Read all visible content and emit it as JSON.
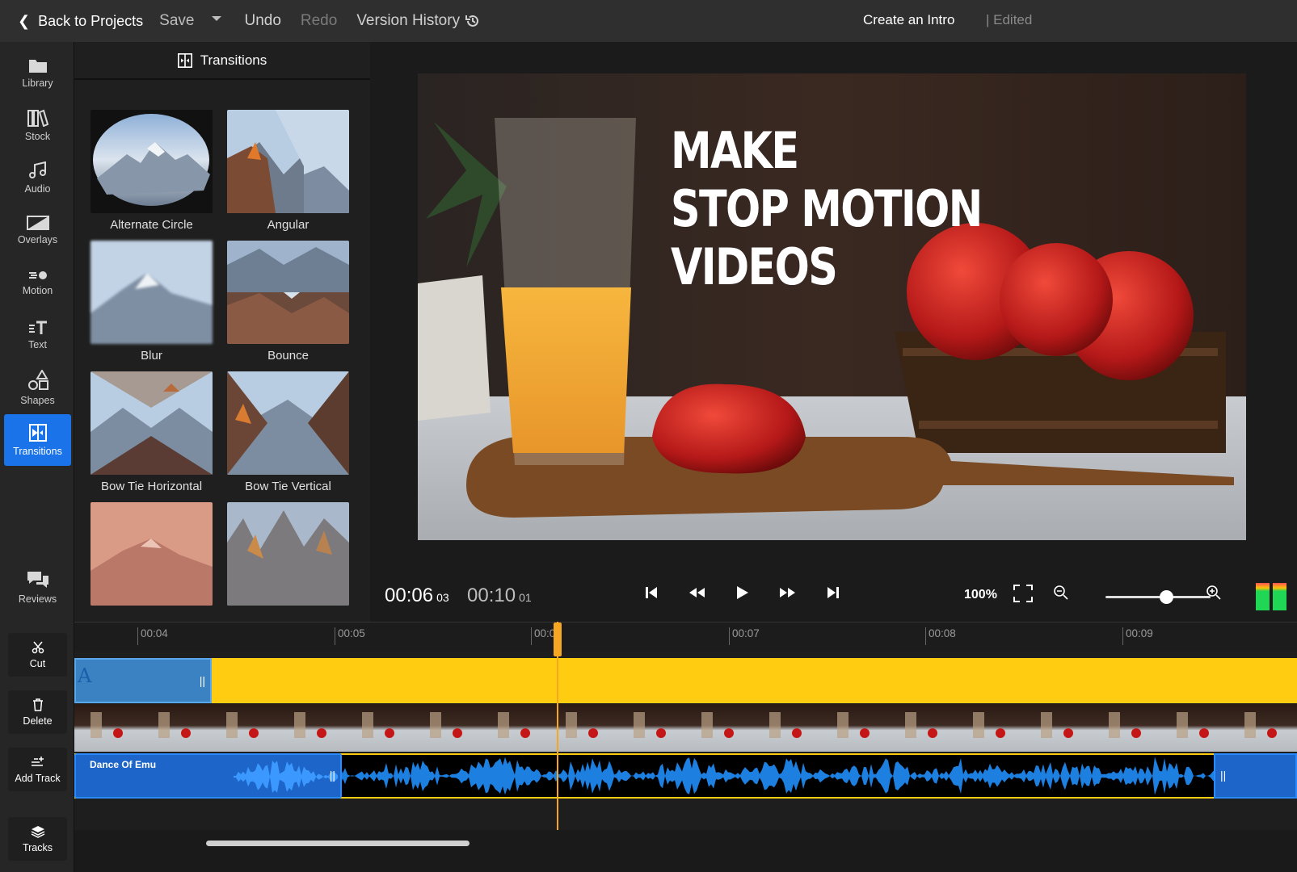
{
  "topbar": {
    "back_label": "Back to Projects",
    "save_label": "Save",
    "undo_label": "Undo",
    "redo_label": "Redo",
    "version_history_label": "Version History",
    "project_name": "Create an Intro",
    "status": "| Edited"
  },
  "rail": {
    "items": [
      {
        "label": "Library",
        "icon": "folder-icon"
      },
      {
        "label": "Stock",
        "icon": "books-icon"
      },
      {
        "label": "Audio",
        "icon": "music-note-icon"
      },
      {
        "label": "Overlays",
        "icon": "overlay-icon"
      },
      {
        "label": "Motion",
        "icon": "motion-icon"
      },
      {
        "label": "Text",
        "icon": "text-icon"
      },
      {
        "label": "Shapes",
        "icon": "shapes-icon"
      },
      {
        "label": "Transitions",
        "icon": "transitions-icon",
        "active": true
      },
      {
        "label": "Reviews",
        "icon": "chat-icon"
      }
    ]
  },
  "panel": {
    "title": "Transitions",
    "tiles": [
      {
        "label": "Alternate Circle"
      },
      {
        "label": "Angular"
      },
      {
        "label": "Blur"
      },
      {
        "label": "Bounce"
      },
      {
        "label": "Bow Tie Horizontal"
      },
      {
        "label": "Bow Tie Vertical"
      },
      {
        "label": ""
      },
      {
        "label": ""
      }
    ]
  },
  "preview": {
    "title_lines": [
      "MAKE",
      "STOP MOTION",
      "VIDEOS"
    ]
  },
  "transport": {
    "current_time": "00:06",
    "current_frames": "03",
    "total_time": "00:10",
    "total_frames": "01",
    "zoom": "100%"
  },
  "timeline_tools": [
    {
      "label": "Cut",
      "icon": "scissors-icon"
    },
    {
      "label": "Delete",
      "icon": "trash-icon"
    },
    {
      "label": "Add Track",
      "icon": "add-track-icon"
    },
    {
      "label": "Tracks",
      "icon": "layers-icon"
    }
  ],
  "ruler": {
    "ticks": [
      "00:04",
      "00:05",
      "00:0",
      "00:07",
      "00:08",
      "00:09"
    ]
  },
  "text_clip": {
    "glyph": "A",
    "handle": "||"
  },
  "audio_clip": {
    "name": "Dance Of Emu",
    "handle": "||"
  },
  "colors": {
    "accent": "#1a73e8",
    "text_track": "#ffcc11",
    "playhead": "#f5a623",
    "audio_clip": "#1d65c8"
  }
}
